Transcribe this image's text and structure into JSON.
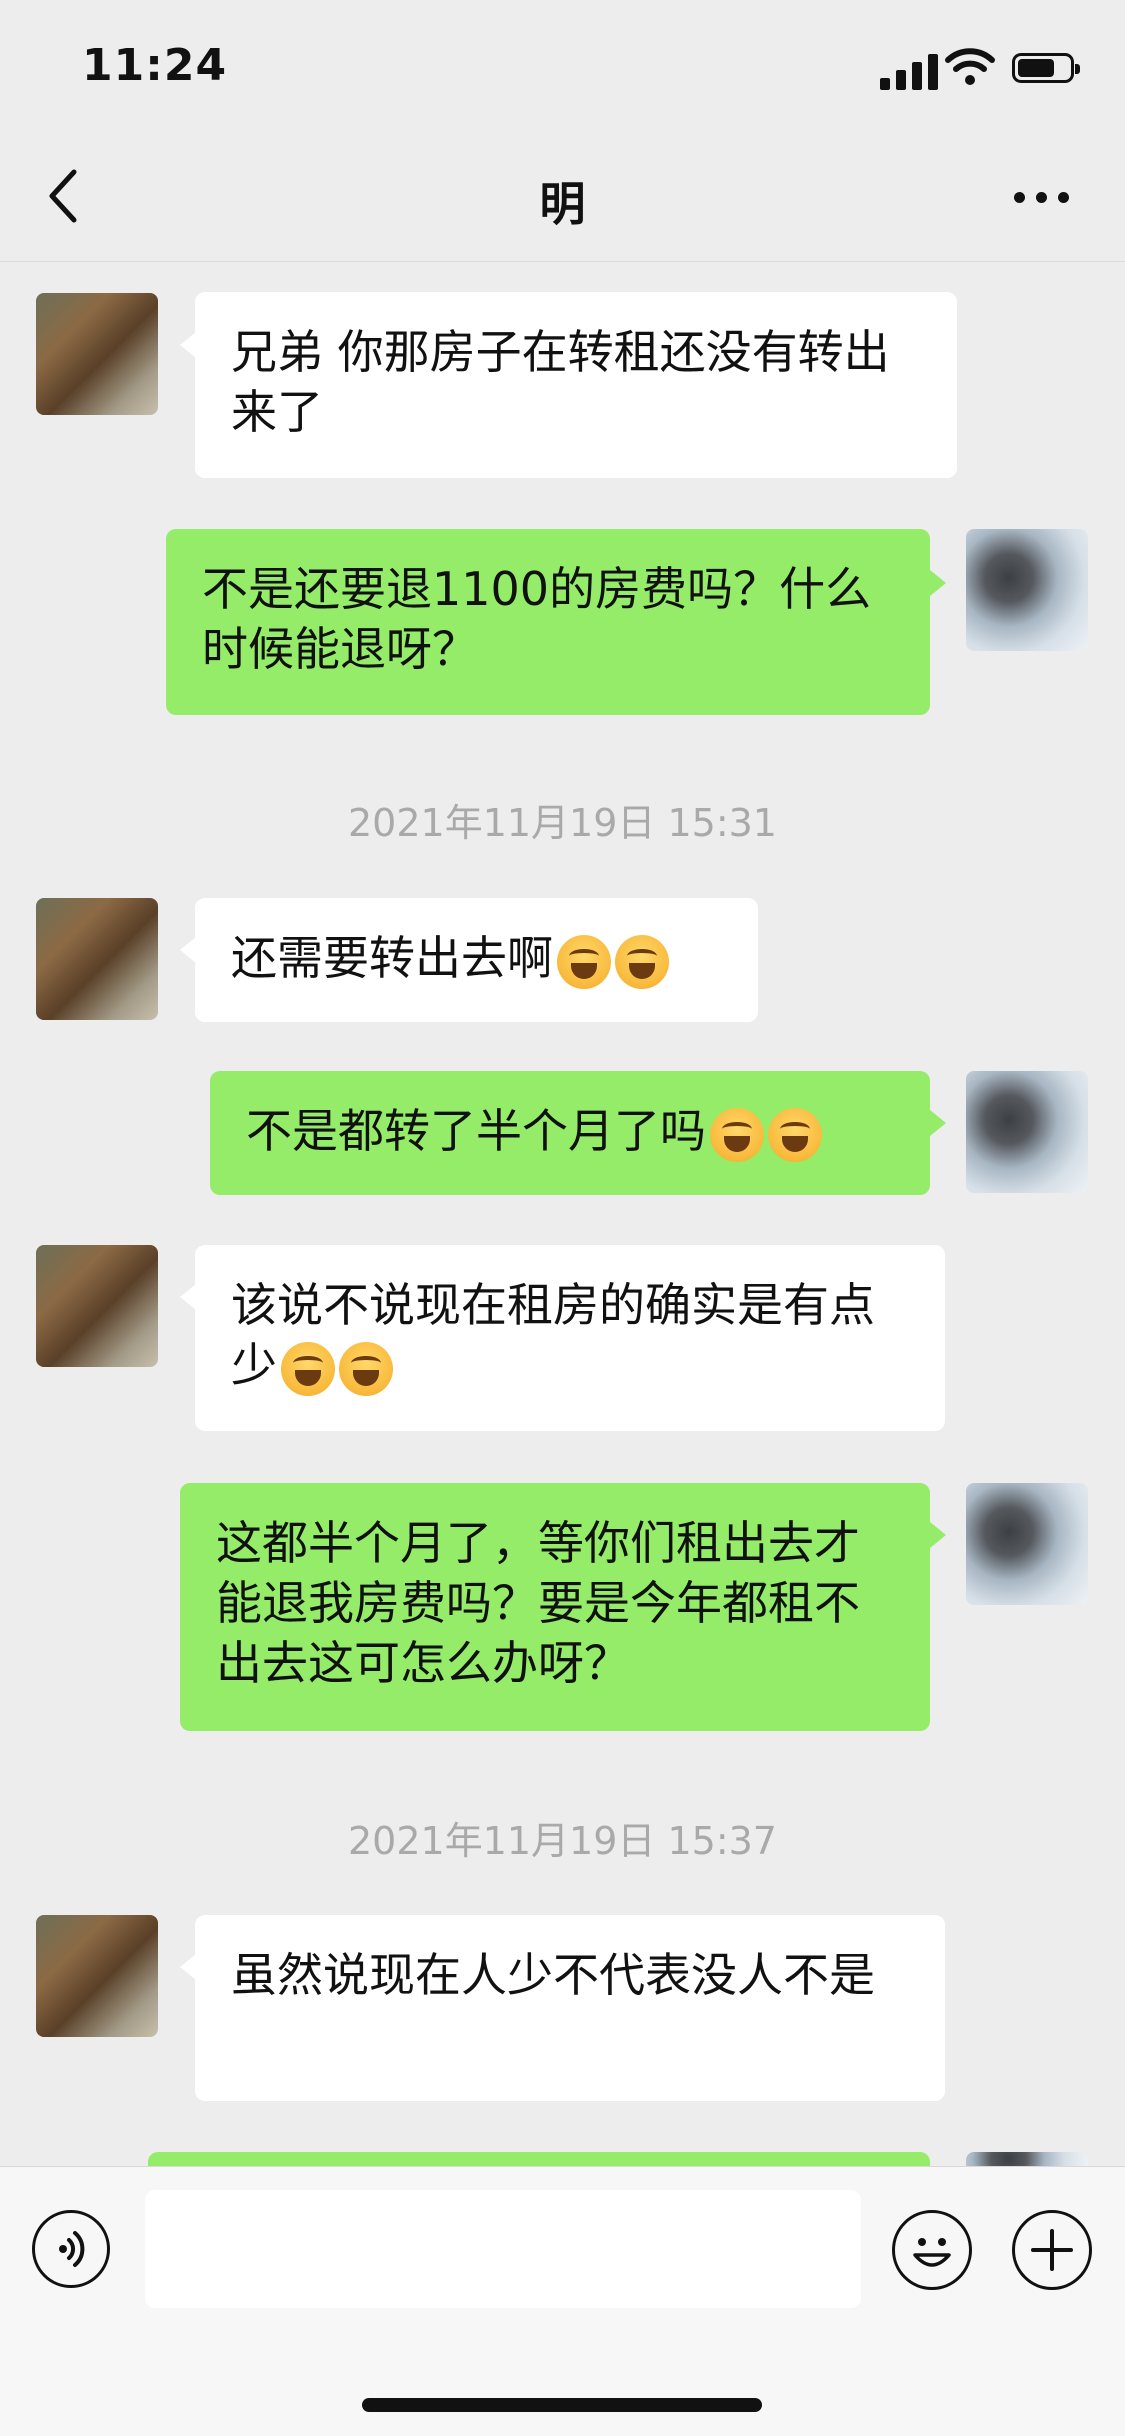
{
  "status_bar": {
    "time": "11:24"
  },
  "nav": {
    "title": "明"
  },
  "messages": [
    {
      "side": "in",
      "text": "兄弟 你那房子在转租还没有转出来了",
      "emoji_count": 0
    },
    {
      "side": "out",
      "text": "不是还要退1100的房费吗？什么时候能退呀？",
      "emoji_count": 0
    },
    {
      "side": "in",
      "text": "还需要转出去啊",
      "emoji_count": 2
    },
    {
      "side": "out",
      "text": "不是都转了半个月了吗",
      "emoji_count": 2
    },
    {
      "side": "in",
      "text": "该说不说现在租房的确实是有点少",
      "emoji_count": 2
    },
    {
      "side": "out",
      "text": "这都半个月了，等你们租出去才能退我房费吗？要是今年都租不出去这可怎么办呀？",
      "emoji_count": 0
    },
    {
      "side": "in",
      "text": "虽然说现在人少不代表没人不是",
      "emoji_count": 0
    }
  ],
  "timestamps": [
    "2021年11月19日 15:31",
    "2021年11月19日 15:37"
  ],
  "icons": {
    "back": "chevron-left-icon",
    "more": "more-icon",
    "voice": "voice-icon",
    "emoji": "emoji-icon",
    "plus": "plus-icon",
    "crying_emoji": "crying-laughing-emoji"
  },
  "colors": {
    "background": "#ededed",
    "outgoing_bubble": "#95ec69",
    "incoming_bubble": "#ffffff",
    "timestamp": "#a9a9a9"
  }
}
